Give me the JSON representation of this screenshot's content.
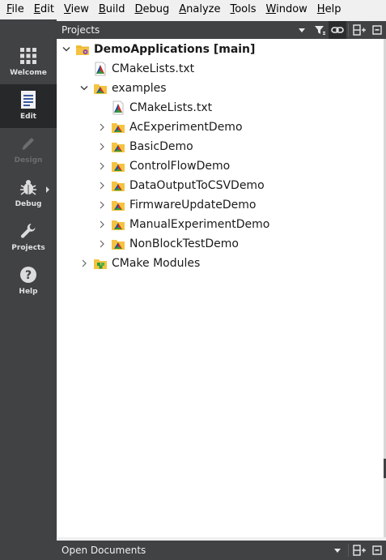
{
  "menu": [
    {
      "key": "F",
      "rest": "ile"
    },
    {
      "key": "E",
      "rest": "dit"
    },
    {
      "key": "V",
      "rest": "iew"
    },
    {
      "key": "B",
      "rest": "uild"
    },
    {
      "key": "D",
      "rest": "ebug"
    },
    {
      "key": "A",
      "rest": "nalyze"
    },
    {
      "key": "T",
      "rest": "ools"
    },
    {
      "key": "W",
      "rest": "indow"
    },
    {
      "key": "H",
      "rest": "elp"
    }
  ],
  "modes": {
    "welcome": "Welcome",
    "edit": "Edit",
    "design": "Design",
    "debug": "Debug",
    "projects": "Projects",
    "help": "Help"
  },
  "projects_panel": {
    "title": "Projects"
  },
  "tree": {
    "root": "DemoApplications [main]",
    "root_cmake": "CMakeLists.txt",
    "examples": "examples",
    "examples_cmake": "CMakeLists.txt",
    "children": [
      "AcExperimentDemo",
      "BasicDemo",
      "ControlFlowDemo",
      "DataOutputToCSVDemo",
      "FirmwareUpdateDemo",
      "ManualExperimentDemo",
      "NonBlockTestDemo"
    ],
    "cmake_modules": "CMake Modules"
  },
  "open_documents_panel": {
    "title": "Open Documents"
  },
  "colors": {
    "sidebar": "#404244",
    "sidebar_active": "#262829",
    "folder": "#f4c341",
    "cmake_red": "#d62d20",
    "cmake_blue": "#1f4fa3",
    "cmake_green": "#2e9c3a"
  }
}
